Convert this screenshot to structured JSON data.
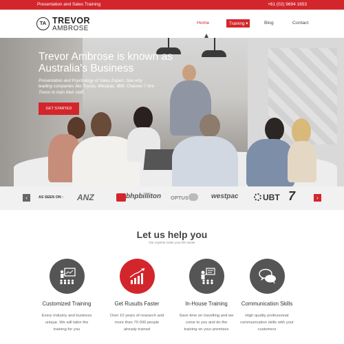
{
  "topbar": {
    "tagline": "Presentation and Sales Training",
    "phone": "+61 (02) 9694 1653"
  },
  "logo": {
    "mark": "TA",
    "first": "TREVOR",
    "last": "AMBROSE"
  },
  "nav": {
    "items": [
      {
        "label": "Home",
        "active": true
      },
      {
        "label": "Training ▾",
        "highlight": true
      },
      {
        "label": "Blog"
      },
      {
        "label": "Contact"
      }
    ]
  },
  "hero": {
    "title": "Trevor Ambrose is known as Australia's Business",
    "subtitle": "Presentation and Psychology of Sales Expert. See why leading companies like Toyota, Westpac, IBM, Channel 7 hire Trevor to train their staff.",
    "button_label": "GET STARTED"
  },
  "seen_on": {
    "label": "AS SEEN ON :",
    "brands": [
      "ANZ",
      "bhpbilliton",
      "OPTUS",
      "westpac",
      "UBT",
      "7"
    ]
  },
  "help": {
    "title": "Let us help you",
    "subtitle": "Our experts make your life easier",
    "cards": [
      {
        "icon": "presentation-icon",
        "title": "Customized Training",
        "text": "Every industry and business unique. We will tailor the training for you"
      },
      {
        "icon": "chart-growth-icon",
        "title": "Get Rusults Faster",
        "text": "Over 10 years of research and more than 70 000 people already trained"
      },
      {
        "icon": "in-house-training-icon",
        "title": "In-House Training",
        "text": "Save time on travelling and we come to you and do the training on your premises"
      },
      {
        "icon": "speech-bubbles-icon",
        "title": "Communication Skills",
        "text": "High quality professional communication skills with your customers"
      }
    ]
  },
  "colors": {
    "brand_red": "#d3262c",
    "icon_gray": "#555555"
  }
}
